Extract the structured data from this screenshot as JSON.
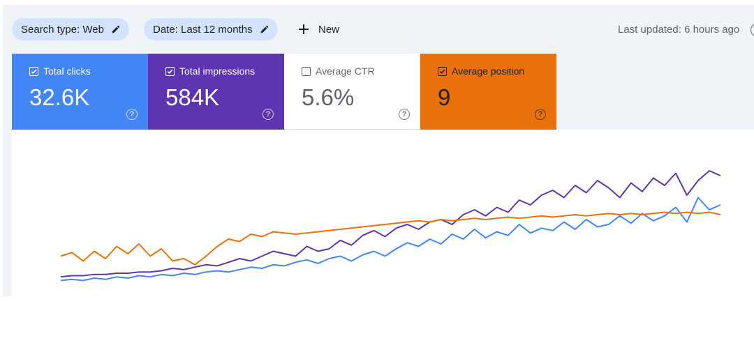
{
  "toolbar": {
    "chips": [
      {
        "label": "Search type: Web"
      },
      {
        "label": "Date: Last 12 months"
      }
    ],
    "new_label": "New",
    "last_updated": "Last updated: 6 hours ago"
  },
  "metric_cards": [
    {
      "label": "Total clicks",
      "value": "32.6K",
      "checked": true,
      "bg": "#4285f4",
      "fg": "#ffffff"
    },
    {
      "label": "Total impressions",
      "value": "584K",
      "checked": true,
      "bg": "#5e35b1",
      "fg": "#ffffff"
    },
    {
      "label": "Average CTR",
      "value": "5.6%",
      "checked": false,
      "bg": "#ffffff",
      "fg": "#5f6368"
    },
    {
      "label": "Average position",
      "value": "9",
      "checked": true,
      "bg": "#e8710a",
      "fg": "#202124"
    }
  ],
  "icons": {
    "help": "?"
  },
  "chart_data": {
    "type": "line",
    "title": "",
    "xlabel": "",
    "ylabel": "",
    "grid": false,
    "legend": "none",
    "x_count": 60,
    "series": [
      {
        "color": "#4285f4",
        "values": [
          0.02,
          0.03,
          0.02,
          0.04,
          0.03,
          0.05,
          0.04,
          0.06,
          0.05,
          0.07,
          0.06,
          0.08,
          0.07,
          0.09,
          0.1,
          0.09,
          0.11,
          0.13,
          0.12,
          0.15,
          0.14,
          0.17,
          0.19,
          0.16,
          0.2,
          0.22,
          0.18,
          0.23,
          0.26,
          0.22,
          0.28,
          0.33,
          0.3,
          0.36,
          0.32,
          0.4,
          0.36,
          0.44,
          0.37,
          0.42,
          0.39,
          0.48,
          0.41,
          0.45,
          0.43,
          0.5,
          0.44,
          0.52,
          0.46,
          0.48,
          0.55,
          0.49,
          0.57,
          0.51,
          0.55,
          0.62,
          0.5,
          0.7,
          0.6,
          0.64
        ]
      },
      {
        "color": "#5e35b1",
        "values": [
          0.05,
          0.06,
          0.06,
          0.07,
          0.07,
          0.08,
          0.08,
          0.09,
          0.09,
          0.1,
          0.12,
          0.11,
          0.13,
          0.15,
          0.14,
          0.17,
          0.2,
          0.18,
          0.22,
          0.26,
          0.24,
          0.22,
          0.3,
          0.26,
          0.28,
          0.35,
          0.31,
          0.39,
          0.43,
          0.38,
          0.45,
          0.48,
          0.44,
          0.5,
          0.52,
          0.48,
          0.56,
          0.6,
          0.55,
          0.62,
          0.58,
          0.68,
          0.64,
          0.72,
          0.76,
          0.7,
          0.8,
          0.74,
          0.84,
          0.78,
          0.7,
          0.82,
          0.75,
          0.86,
          0.8,
          0.9,
          0.72,
          0.84,
          0.92,
          0.88
        ]
      },
      {
        "color": "#e8710a",
        "values": [
          0.22,
          0.25,
          0.18,
          0.26,
          0.2,
          0.3,
          0.24,
          0.32,
          0.22,
          0.28,
          0.18,
          0.2,
          0.15,
          0.22,
          0.3,
          0.36,
          0.34,
          0.4,
          0.38,
          0.42,
          0.41,
          0.4,
          0.41,
          0.42,
          0.43,
          0.44,
          0.45,
          0.46,
          0.47,
          0.48,
          0.49,
          0.5,
          0.51,
          0.5,
          0.52,
          0.51,
          0.52,
          0.53,
          0.52,
          0.53,
          0.54,
          0.53,
          0.54,
          0.55,
          0.54,
          0.55,
          0.56,
          0.55,
          0.56,
          0.57,
          0.56,
          0.57,
          0.56,
          0.57,
          0.58,
          0.57,
          0.58,
          0.57,
          0.58,
          0.56
        ]
      }
    ]
  }
}
